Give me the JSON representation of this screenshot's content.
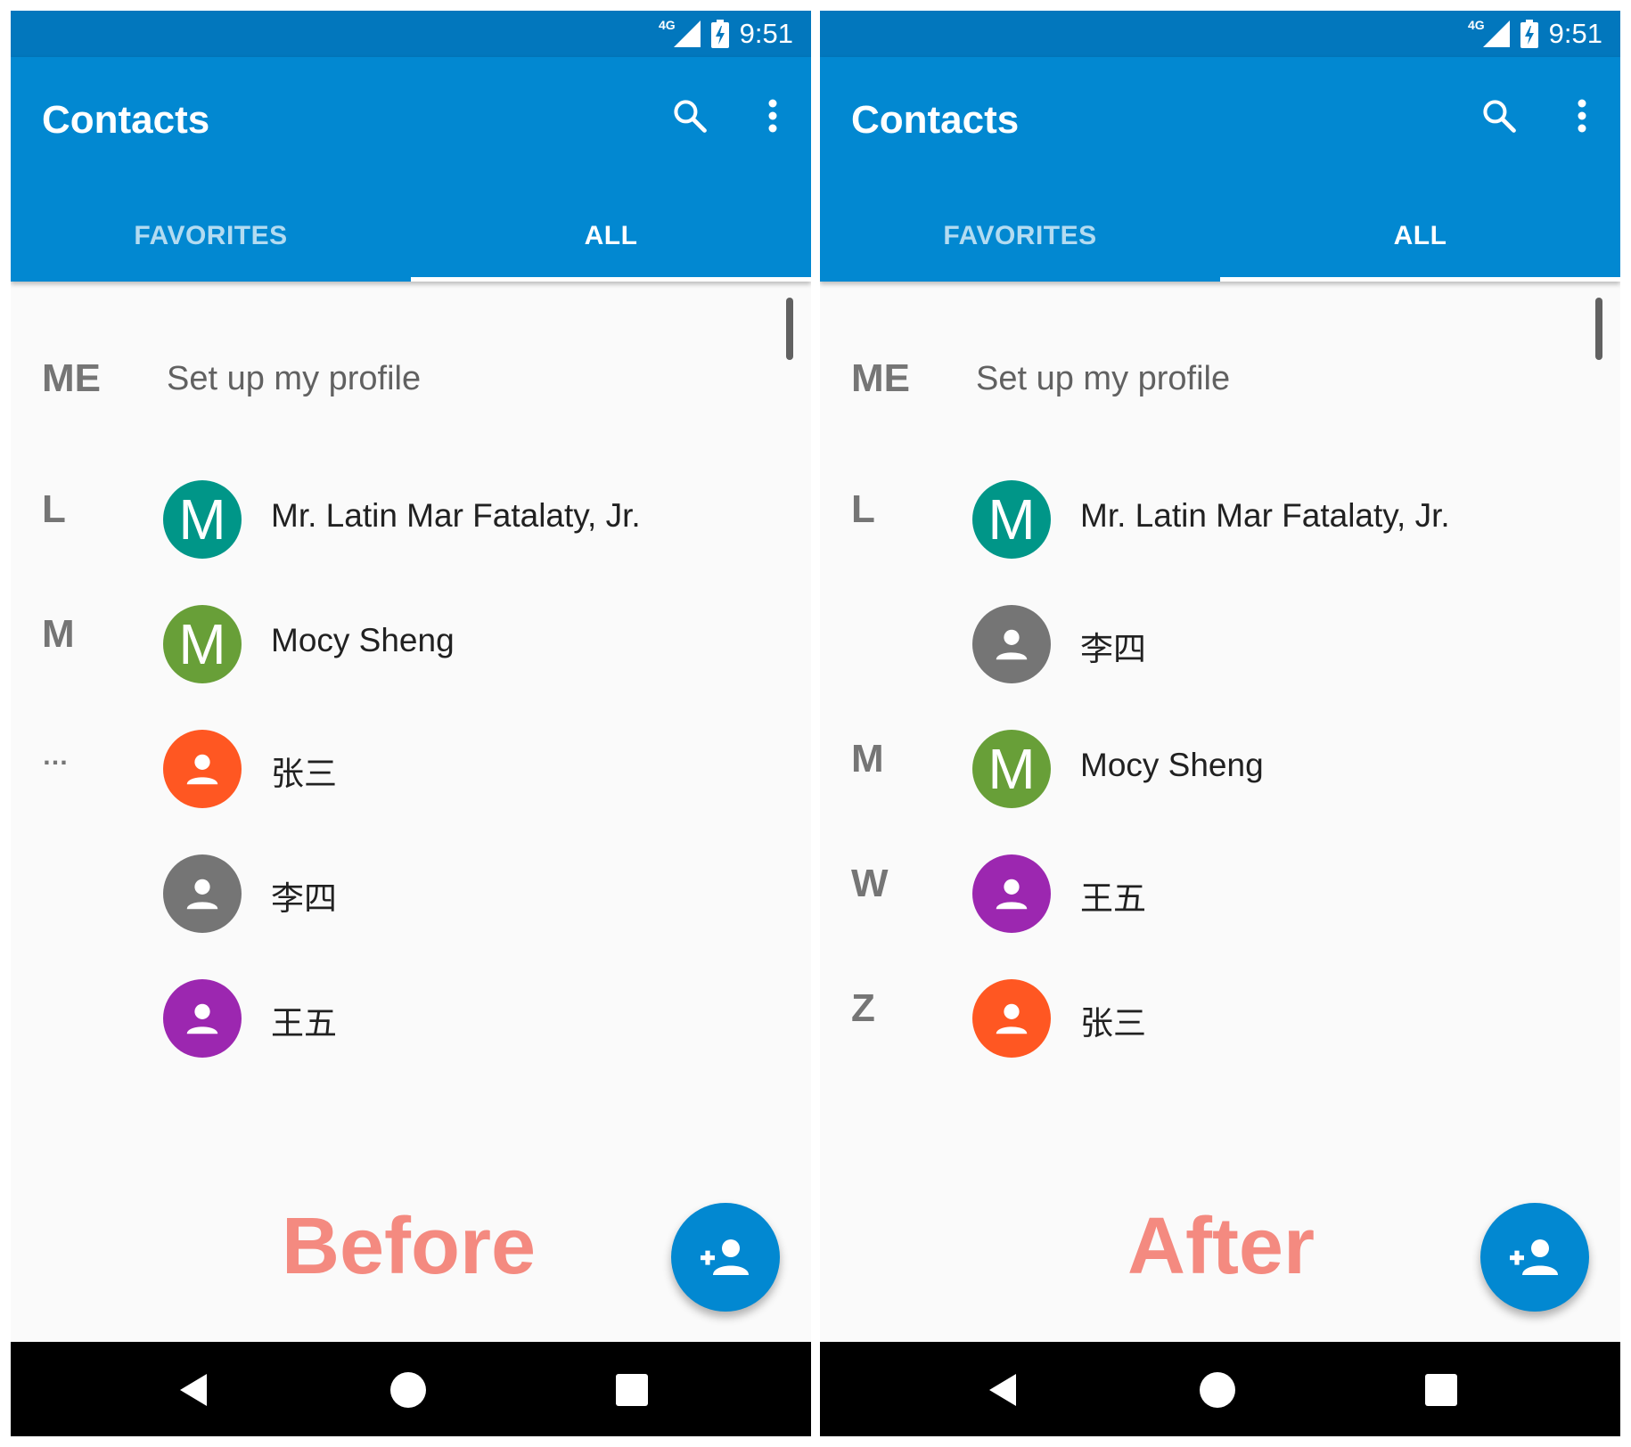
{
  "before": {
    "status": {
      "network": "4G",
      "time": "9:51"
    },
    "app_title": "Contacts",
    "tabs": [
      {
        "label": "FAVORITES"
      },
      {
        "label": "ALL"
      }
    ],
    "me_section": {
      "letter": "ME",
      "text": "Set up my profile"
    },
    "contacts": [
      {
        "section": "L",
        "initial": "M",
        "name": "Mr. Latin Mar Fatalaty, Jr.",
        "color": "#009688"
      },
      {
        "section": "M",
        "initial": "M",
        "name": "Mocy Sheng",
        "color": "#689f38"
      },
      {
        "section": "…",
        "initial": "",
        "name": "张三",
        "color": "#ff5722"
      },
      {
        "section": "",
        "initial": "",
        "name": "李四",
        "color": "#757575"
      },
      {
        "section": "",
        "initial": "",
        "name": "王五",
        "color": "#9c27b0"
      }
    ],
    "label": "Before"
  },
  "after": {
    "status": {
      "network": "4G",
      "time": "9:51"
    },
    "app_title": "Contacts",
    "tabs": [
      {
        "label": "FAVORITES"
      },
      {
        "label": "ALL"
      }
    ],
    "me_section": {
      "letter": "ME",
      "text": "Set up my profile"
    },
    "contacts": [
      {
        "section": "L",
        "initial": "M",
        "name": "Mr. Latin Mar Fatalaty, Jr.",
        "color": "#009688"
      },
      {
        "section": "",
        "initial": "",
        "name": "李四",
        "color": "#757575"
      },
      {
        "section": "M",
        "initial": "M",
        "name": "Mocy Sheng",
        "color": "#689f38"
      },
      {
        "section": "W",
        "initial": "",
        "name": "王五",
        "color": "#9c27b0"
      },
      {
        "section": "Z",
        "initial": "",
        "name": "张三",
        "color": "#ff5722"
      }
    ],
    "label": "After"
  },
  "colors": {
    "status_bar": "#0277bd",
    "app_bar": "#0288d1",
    "fab": "#0288d1",
    "label": "#f48a80"
  },
  "icons": {
    "search": "search-icon",
    "more": "more-vert-icon",
    "fab": "person-add-icon",
    "avatar_placeholder": "person-icon",
    "signal": "signal-icon",
    "battery": "battery-charging-icon",
    "nav_back": "back-icon",
    "nav_home": "home-icon",
    "nav_recents": "recents-icon"
  }
}
